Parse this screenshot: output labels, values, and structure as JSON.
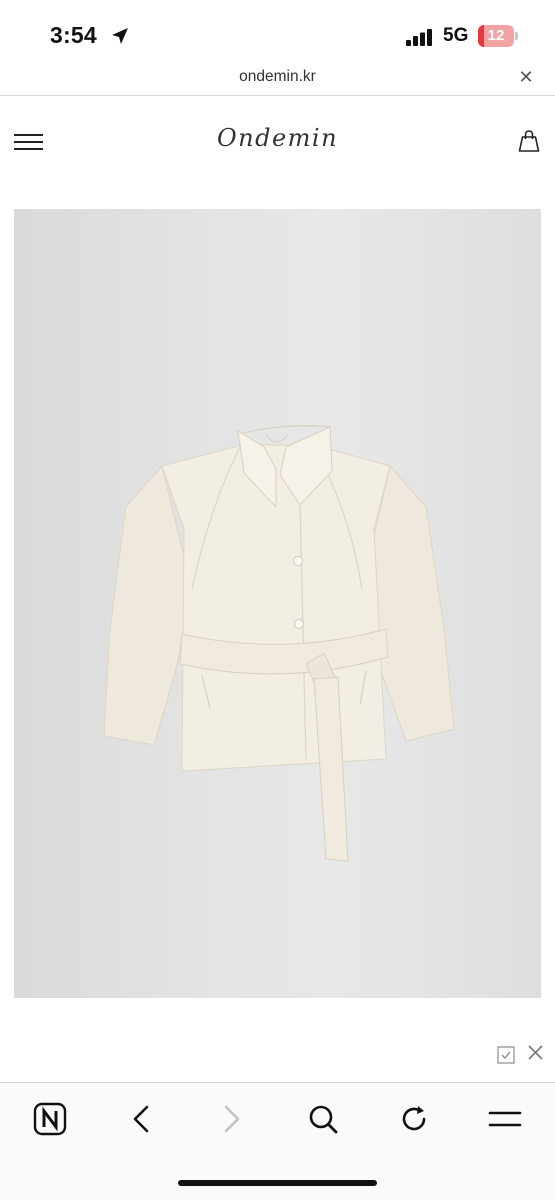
{
  "status_bar": {
    "time": "3:54",
    "network": "5G",
    "battery": "12",
    "battery_level": 0.12,
    "battery_color": "#e5393f"
  },
  "browser": {
    "url": "ondemin.kr",
    "close_label": "✕"
  },
  "site": {
    "logo_text": "Ondemin",
    "icons": [
      "hamburger-menu-icon",
      "shopping-bag-icon"
    ]
  },
  "product": {
    "image_subject": "cream-wool-belted-jacket",
    "background_color": "#e3e3e3",
    "garment_color": "#f3eee3"
  },
  "ad": {
    "icons": [
      "ad-info-icon",
      "ad-close-icon"
    ]
  },
  "toolbar": {
    "buttons": [
      "naver-home-icon",
      "back-icon",
      "forward-icon",
      "search-icon",
      "reload-icon",
      "menu-icon"
    ],
    "forward_enabled": false
  }
}
